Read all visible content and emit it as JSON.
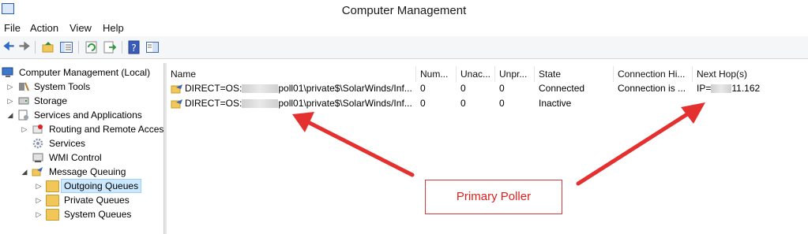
{
  "window": {
    "title": "Computer Management"
  },
  "menu": {
    "items": [
      "File",
      "Action",
      "View",
      "Help"
    ]
  },
  "toolbar": {
    "icons": [
      "back-icon",
      "forward-icon",
      "up-icon",
      "show-hide-tree-icon",
      "refresh-icon",
      "export-icon",
      "help-icon",
      "properties-icon"
    ]
  },
  "tree": {
    "items": [
      {
        "label": "Computer Management (Local)",
        "icon": "computer-icon"
      },
      {
        "label": "System Tools",
        "icon": "tools-icon"
      },
      {
        "label": "Storage",
        "icon": "storage-icon"
      },
      {
        "label": "Services and Applications",
        "icon": "services-apps-icon"
      },
      {
        "label": "Routing and Remote Acces",
        "icon": "routing-icon"
      },
      {
        "label": "Services",
        "icon": "gear-icon"
      },
      {
        "label": "WMI Control",
        "icon": "wmi-icon"
      },
      {
        "label": "Message Queuing",
        "icon": "message-queuing-icon"
      },
      {
        "label": "Outgoing Queues",
        "icon": "folder-icon"
      },
      {
        "label": "Private Queues",
        "icon": "folder-icon"
      },
      {
        "label": "System Queues",
        "icon": "folder-icon"
      }
    ]
  },
  "list": {
    "columns": [
      "Name",
      "Num...",
      "Unac...",
      "Unpr...",
      "State",
      "Connection Hi...",
      "Next Hop(s)"
    ],
    "rows": [
      {
        "name_prefix": "DIRECT=OS:",
        "name_suffix": "poll01\\private$\\SolarWinds/Inf...",
        "num": "0",
        "unac": "0",
        "unpr": "0",
        "state": "Connected",
        "conn": "Connection is ...",
        "hop_prefix": "IP=",
        "hop_suffix": "11.162"
      },
      {
        "name_prefix": "DIRECT=OS:",
        "name_suffix": "poll01\\private$\\SolarWinds/Inf...",
        "num": "0",
        "unac": "0",
        "unpr": "0",
        "state": "Inactive",
        "conn": "",
        "hop_prefix": "",
        "hop_suffix": ""
      }
    ]
  },
  "annotation": {
    "label": "Primary Poller",
    "color": "#e0201e"
  }
}
